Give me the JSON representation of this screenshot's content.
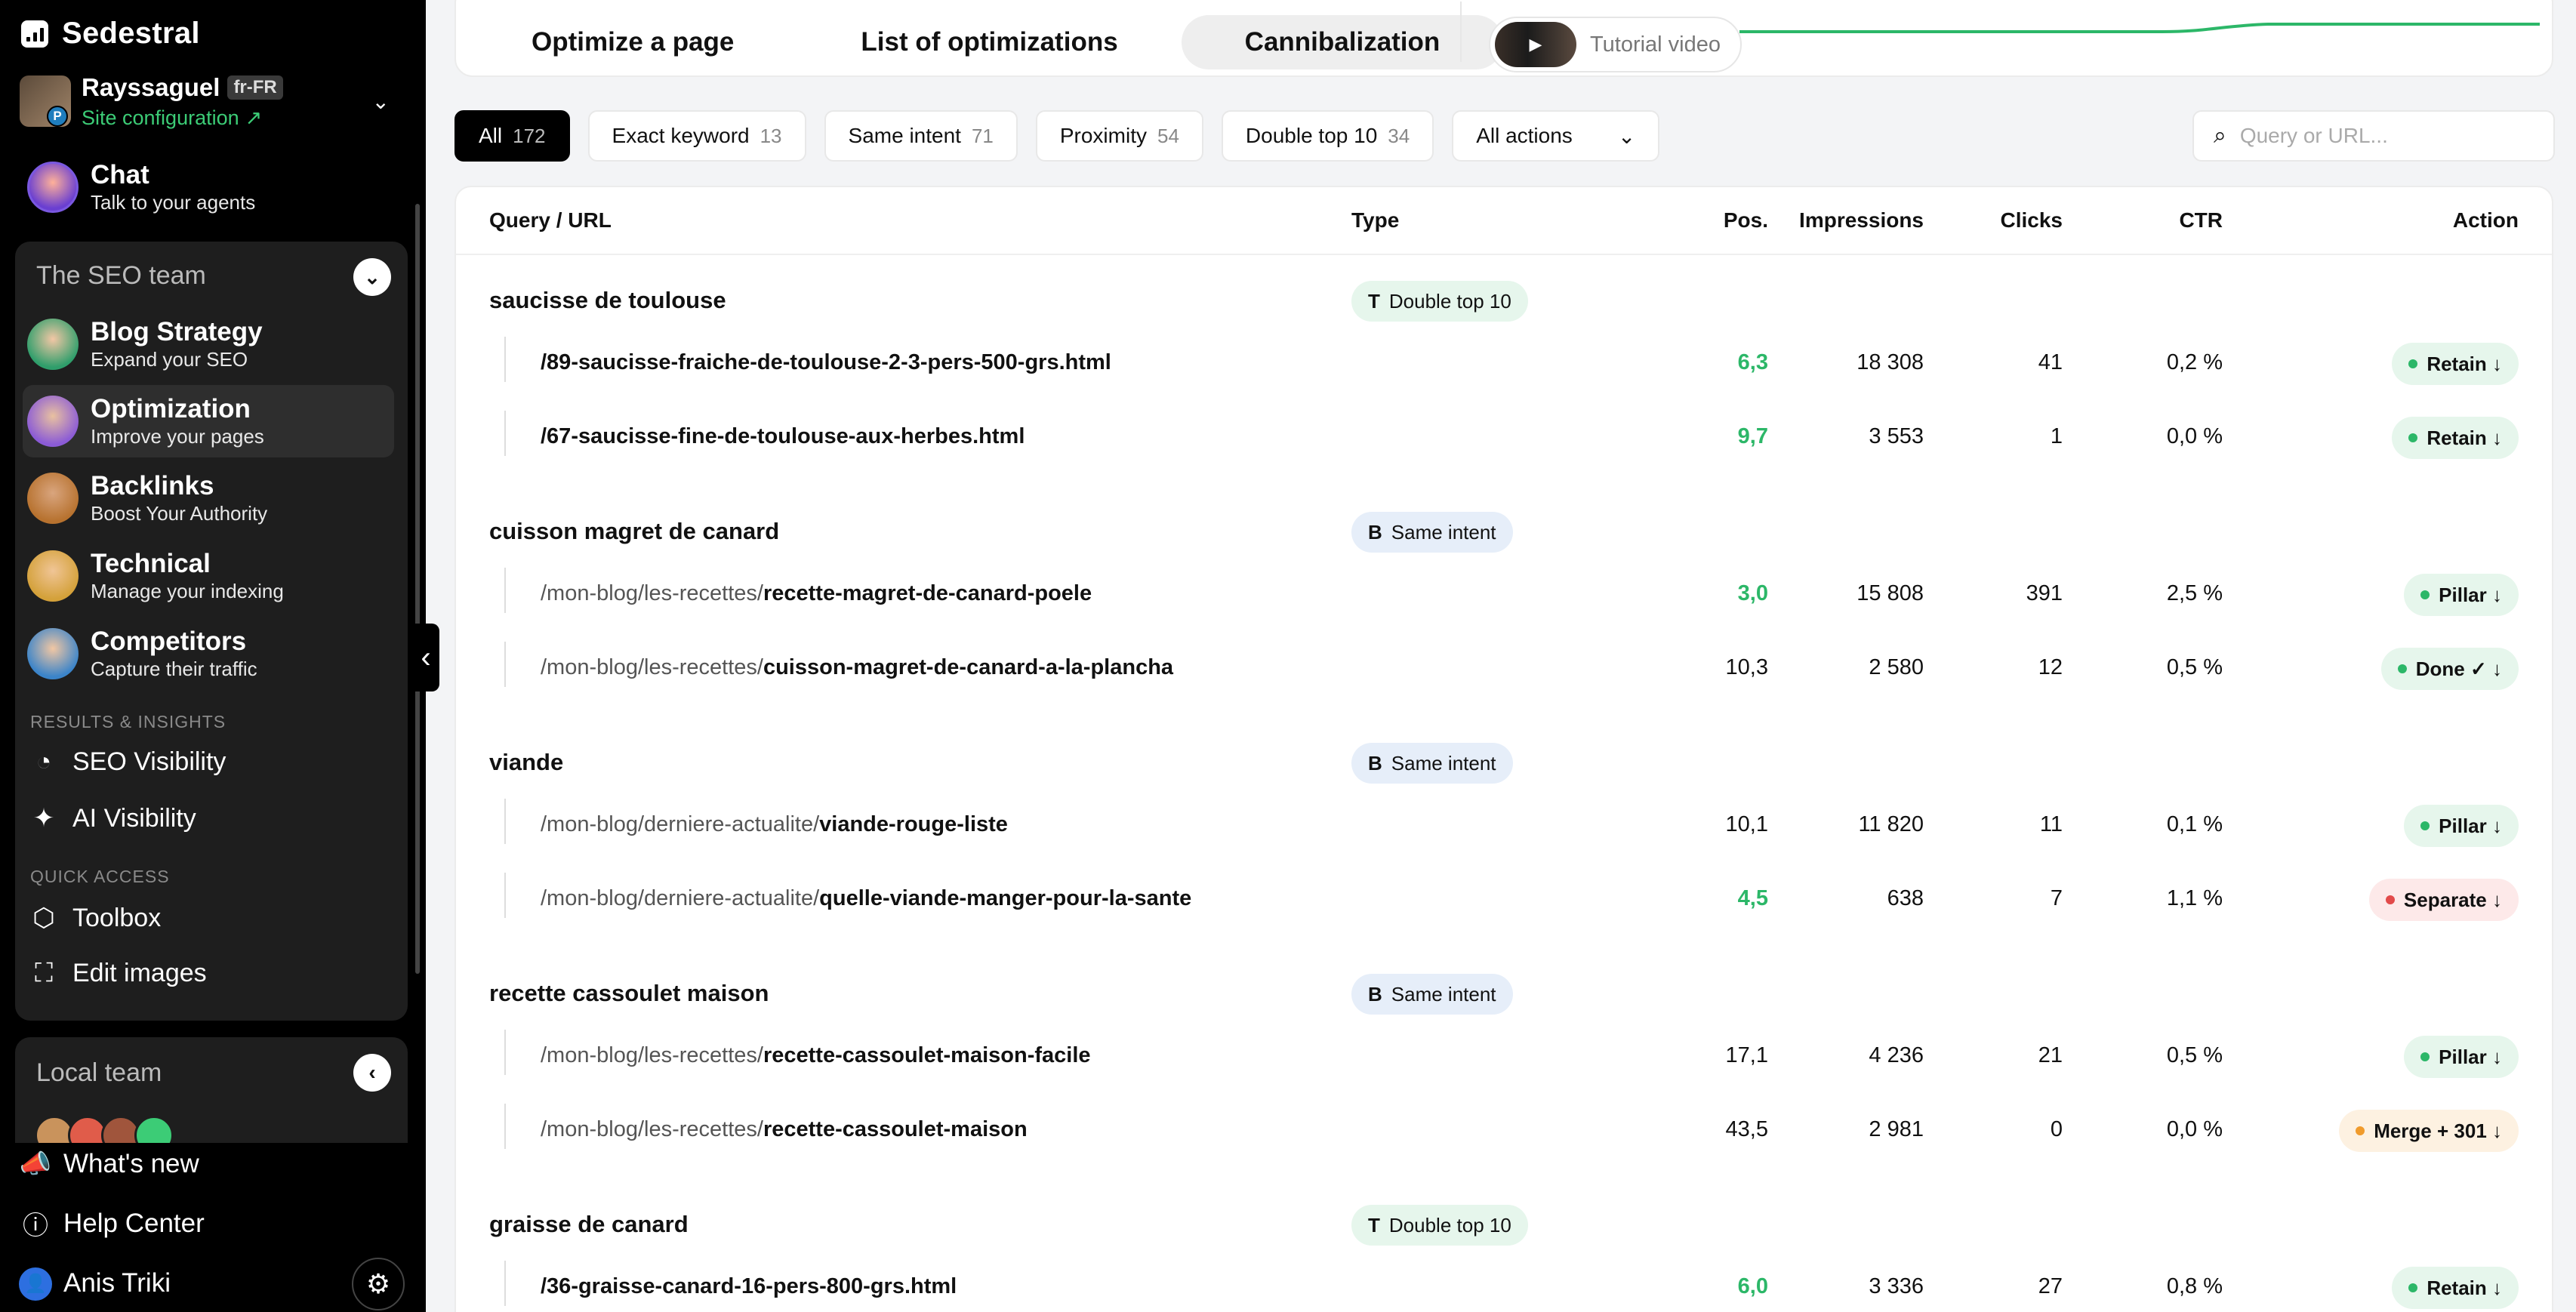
{
  "brand": {
    "name": "Sedestral"
  },
  "site": {
    "name": "Rayssaguel",
    "locale": "fr-FR",
    "config_label": "Site configuration",
    "initial": "P"
  },
  "chat": {
    "title": "Chat",
    "subtitle": "Talk to your agents"
  },
  "seo_team": {
    "title": "The SEO team",
    "agents": [
      {
        "title": "Blog Strategy",
        "subtitle": "Expand your SEO"
      },
      {
        "title": "Optimization",
        "subtitle": "Improve your pages"
      },
      {
        "title": "Backlinks",
        "subtitle": "Boost Your Authority"
      },
      {
        "title": "Technical",
        "subtitle": "Manage your indexing"
      },
      {
        "title": "Competitors",
        "subtitle": "Capture their traffic"
      }
    ],
    "results_label": "RESULTS & INSIGHTS",
    "results": [
      {
        "label": "SEO Visibility"
      },
      {
        "label": "AI Visibility"
      }
    ],
    "quick_label": "QUICK ACCESS",
    "quick": [
      {
        "label": "Toolbox"
      },
      {
        "label": "Edit images"
      }
    ]
  },
  "local_team": {
    "title": "Local team"
  },
  "bottom": {
    "whats_new": "What's new",
    "help": "Help Center",
    "user": "Anis Triki"
  },
  "tabs": [
    {
      "label": "Optimize a page",
      "active": false
    },
    {
      "label": "List of optimizations",
      "active": false
    },
    {
      "label": "Cannibalization",
      "active": true
    }
  ],
  "tutorial": {
    "label": "Tutorial video"
  },
  "filters": [
    {
      "label": "All",
      "count": "172",
      "active": true
    },
    {
      "label": "Exact keyword",
      "count": "13"
    },
    {
      "label": "Same intent",
      "count": "71"
    },
    {
      "label": "Proximity",
      "count": "54"
    },
    {
      "label": "Double top 10",
      "count": "34"
    }
  ],
  "actions_select": {
    "label": "All actions"
  },
  "search": {
    "placeholder": "Query or URL...",
    "value": ""
  },
  "table": {
    "headers": {
      "query": "Query / URL",
      "type": "Type",
      "pos": "Pos.",
      "impressions": "Impressions",
      "clicks": "Clicks",
      "ctr": "CTR",
      "action": "Action"
    },
    "groups": [
      {
        "query": "saucisse de toulouse",
        "type_letter": "T",
        "type": "Double top 10",
        "type_style": "t",
        "rows": [
          {
            "prefix": "",
            "slug": "/89-saucisse-fraiche-de-toulouse-2-3-pers-500-grs.html",
            "pos": "6,3",
            "pos_green": true,
            "impressions": "18 308",
            "clicks": "41",
            "ctr": "0,2 %",
            "action": "Retain ↓",
            "action_style": "green"
          },
          {
            "prefix": "",
            "slug": "/67-saucisse-fine-de-toulouse-aux-herbes.html",
            "pos": "9,7",
            "pos_green": true,
            "impressions": "3 553",
            "clicks": "1",
            "ctr": "0,0 %",
            "action": "Retain ↓",
            "action_style": "green"
          }
        ]
      },
      {
        "query": "cuisson magret de canard",
        "type_letter": "B",
        "type": "Same intent",
        "type_style": "b",
        "rows": [
          {
            "prefix": "/mon-blog/les-recettes/",
            "slug": "recette-magret-de-canard-poele",
            "pos": "3,0",
            "pos_green": true,
            "impressions": "15 808",
            "clicks": "391",
            "ctr": "2,5 %",
            "action": "Pillar ↓",
            "action_style": "green"
          },
          {
            "prefix": "/mon-blog/les-recettes/",
            "slug": "cuisson-magret-de-canard-a-la-plancha",
            "pos": "10,3",
            "pos_green": false,
            "impressions": "2 580",
            "clicks": "12",
            "ctr": "0,5 %",
            "action": "Done ✓ ↓",
            "action_style": "green"
          }
        ]
      },
      {
        "query": "viande",
        "type_letter": "B",
        "type": "Same intent",
        "type_style": "b",
        "rows": [
          {
            "prefix": "/mon-blog/derniere-actualite/",
            "slug": "viande-rouge-liste",
            "pos": "10,1",
            "pos_green": false,
            "impressions": "11 820",
            "clicks": "11",
            "ctr": "0,1 %",
            "action": "Pillar ↓",
            "action_style": "green"
          },
          {
            "prefix": "/mon-blog/derniere-actualite/",
            "slug": "quelle-viande-manger-pour-la-sante",
            "pos": "4,5",
            "pos_green": true,
            "impressions": "638",
            "clicks": "7",
            "ctr": "1,1 %",
            "action": "Separate ↓",
            "action_style": "red"
          }
        ]
      },
      {
        "query": "recette cassoulet maison",
        "type_letter": "B",
        "type": "Same intent",
        "type_style": "b",
        "rows": [
          {
            "prefix": "/mon-blog/les-recettes/",
            "slug": "recette-cassoulet-maison-facile",
            "pos": "17,1",
            "pos_green": false,
            "impressions": "4 236",
            "clicks": "21",
            "ctr": "0,5 %",
            "action": "Pillar ↓",
            "action_style": "green"
          },
          {
            "prefix": "/mon-blog/les-recettes/",
            "slug": "recette-cassoulet-maison",
            "pos": "43,5",
            "pos_green": false,
            "impressions": "2 981",
            "clicks": "0",
            "ctr": "0,0 %",
            "action": "Merge + 301 ↓",
            "action_style": "orange"
          }
        ]
      },
      {
        "query": "graisse de canard",
        "type_letter": "T",
        "type": "Double top 10",
        "type_style": "t",
        "rows": [
          {
            "prefix": "",
            "slug": "/36-graisse-canard-16-pers-800-grs.html",
            "pos": "6,0",
            "pos_green": true,
            "impressions": "3 336",
            "clicks": "27",
            "ctr": "0,8 %",
            "action": "Retain ↓",
            "action_style": "green"
          }
        ]
      }
    ]
  }
}
